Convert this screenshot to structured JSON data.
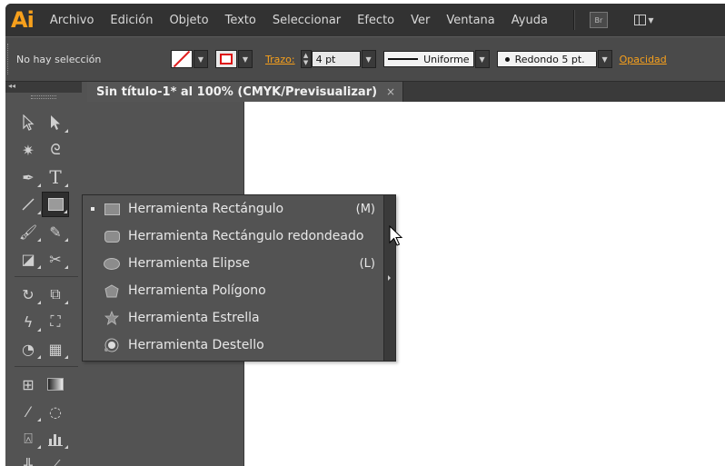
{
  "app": {
    "logo": "Ai",
    "accent": "#f7a01c"
  },
  "menu": [
    "Archivo",
    "Edición",
    "Objeto",
    "Texto",
    "Seleccionar",
    "Efecto",
    "Ver",
    "Ventana",
    "Ayuda"
  ],
  "menu_buttons": {
    "bridge": "Br"
  },
  "control": {
    "selection": "No hay selección",
    "stroke_link": "Trazo:",
    "stroke_weight": "4 pt",
    "stroke_profile": "Uniforme",
    "brush": "Redondo 5 pt.",
    "opacity_link": "Opacidad"
  },
  "toolbox": {
    "collapse": "◂◂"
  },
  "document": {
    "tab": "Sin título-1* al 100% (CMYK/Previsualizar)",
    "close": "×"
  },
  "flyout": {
    "items": [
      {
        "label": "Herramienta Rectángulo",
        "shortcut": "(M)",
        "icon": "rectangle-icon",
        "selected": true
      },
      {
        "label": "Herramienta Rectángulo redondeado",
        "shortcut": "",
        "icon": "rounded-rectangle-icon",
        "selected": false
      },
      {
        "label": "Herramienta Elipse",
        "shortcut": "(L)",
        "icon": "ellipse-icon",
        "selected": false
      },
      {
        "label": "Herramienta Polígono",
        "shortcut": "",
        "icon": "polygon-icon",
        "selected": false
      },
      {
        "label": "Herramienta Estrella",
        "shortcut": "",
        "icon": "star-icon",
        "selected": false
      },
      {
        "label": "Herramienta Destello",
        "shortcut": "",
        "icon": "flare-icon",
        "selected": false
      }
    ]
  }
}
